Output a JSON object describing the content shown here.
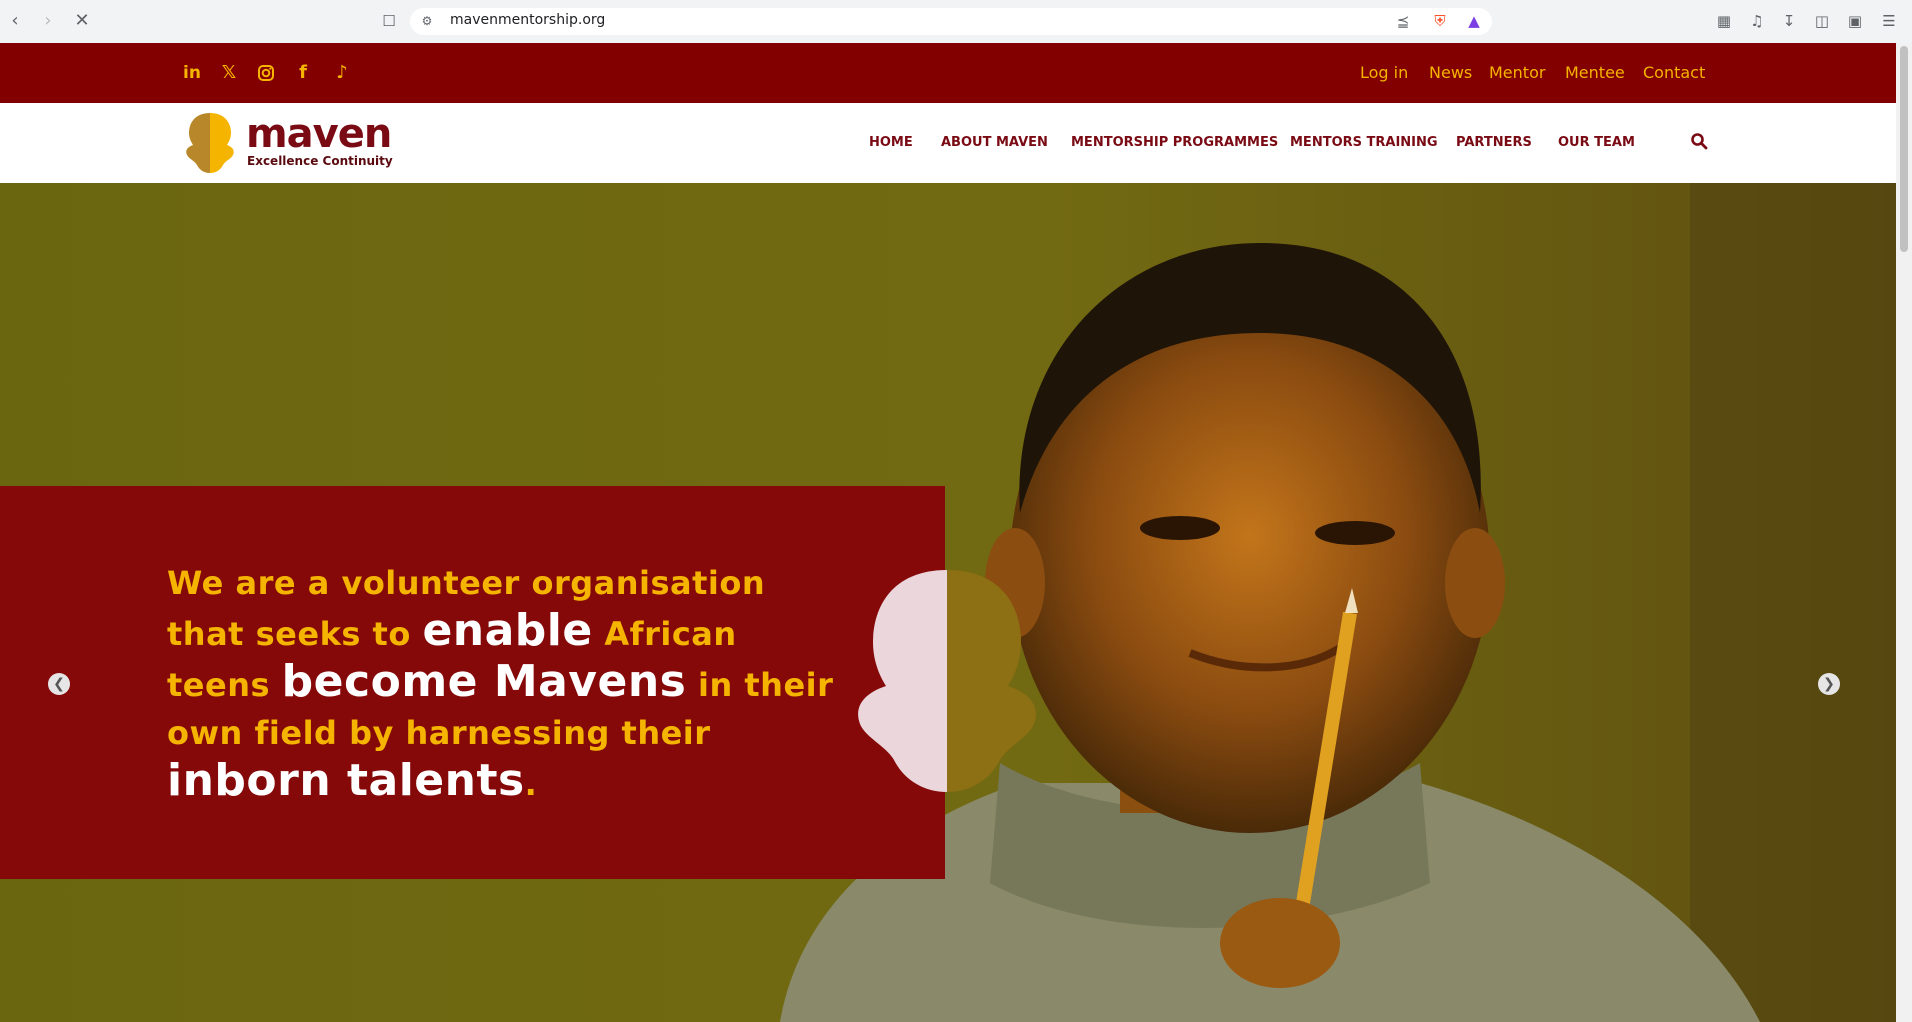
{
  "browser": {
    "url": "mavenmentorship.org"
  },
  "topbar": {
    "social_icons": [
      "linkedin-icon",
      "x-icon",
      "instagram-icon",
      "facebook-icon",
      "tiktok-icon"
    ],
    "links": [
      "Log in",
      "News",
      "Mentor",
      "Mentee",
      "Contact"
    ]
  },
  "logo": {
    "name": "maven",
    "tagline": "Excellence Continuity"
  },
  "nav": {
    "items": [
      "HOME",
      "ABOUT MAVEN",
      "MENTORSHIP PROGRAMMES",
      "MENTORS TRAINING",
      "PARTNERS",
      "OUR TEAM"
    ]
  },
  "hero": {
    "t1": "We are a volunteer organisation that seeks to ",
    "t2": "enable",
    "t3": " African teens ",
    "t4": "become Mavens",
    "t5": " in their own field by harnessing their ",
    "t6": "inborn talents",
    "t7": "."
  },
  "colors": {
    "brand_red": "#830000",
    "brand_gold": "#f5b400"
  }
}
